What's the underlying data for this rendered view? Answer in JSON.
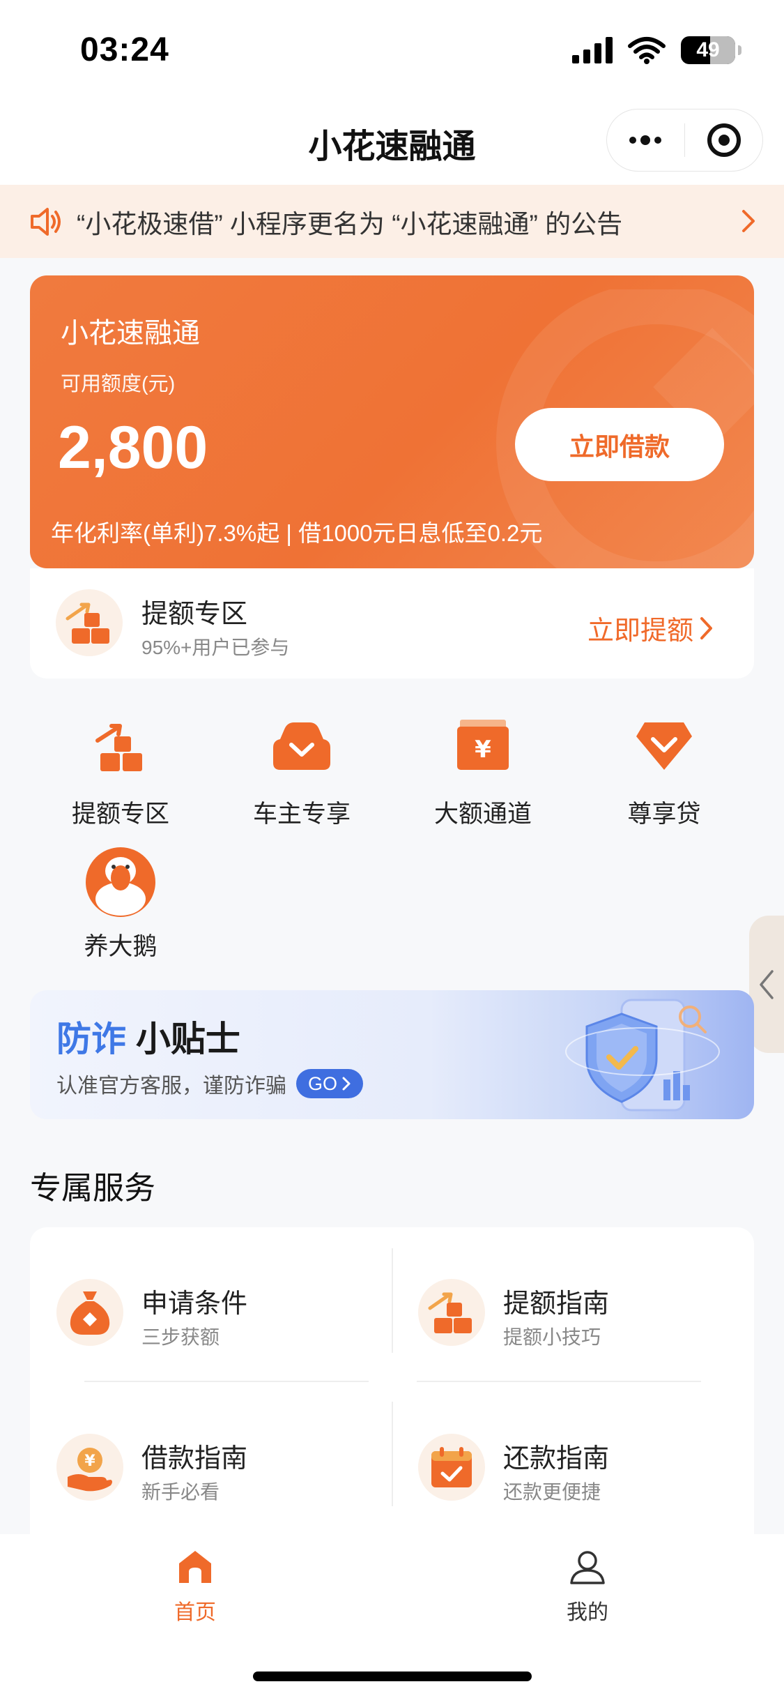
{
  "status_bar": {
    "time": "03:24",
    "battery": "49"
  },
  "nav": {
    "title": "小花速融通"
  },
  "notice": {
    "text": "“小花极速借” 小程序更名为 “小花速融通” 的公告"
  },
  "quota_card": {
    "title": "小花速融通",
    "subtitle": "可用额度(元)",
    "amount": "2,800",
    "button": "立即借款",
    "rate": "年化利率(单利)7.3%起 | 借1000元日息低至0.2元"
  },
  "raise": {
    "title": "提额专区",
    "subtitle": "95%+用户已参与",
    "action": "立即提额"
  },
  "grid": [
    {
      "label": "提额专区",
      "icon": "raise-quota-icon"
    },
    {
      "label": "车主专享",
      "icon": "car-owner-icon"
    },
    {
      "label": "大额通道",
      "icon": "large-amount-icon"
    },
    {
      "label": "尊享贷",
      "icon": "diamond-icon"
    },
    {
      "label": "养大鹅",
      "icon": "goose-icon"
    }
  ],
  "tips": {
    "title_blue": "防诈",
    "title_dark": "小贴士",
    "subtitle": "认准官方客服，谨防诈骗",
    "go": "GO"
  },
  "services": {
    "title": "专属服务",
    "items": [
      {
        "title": "申请条件",
        "subtitle": "三步获额",
        "icon": "money-bag-icon"
      },
      {
        "title": "提额指南",
        "subtitle": "提额小技巧",
        "icon": "raise-quota-icon"
      },
      {
        "title": "借款指南",
        "subtitle": "新手必看",
        "icon": "coin-hand-icon"
      },
      {
        "title": "还款指南",
        "subtitle": "还款更便捷",
        "icon": "calendar-check-icon"
      }
    ]
  },
  "tabbar": {
    "items": [
      {
        "label": "首页",
        "icon": "home-icon",
        "active": true
      },
      {
        "label": "我的",
        "icon": "profile-icon",
        "active": false
      }
    ]
  },
  "colors": {
    "accent": "#ef6a2a",
    "blue": "#3f78e6",
    "inactive": "#333333"
  }
}
